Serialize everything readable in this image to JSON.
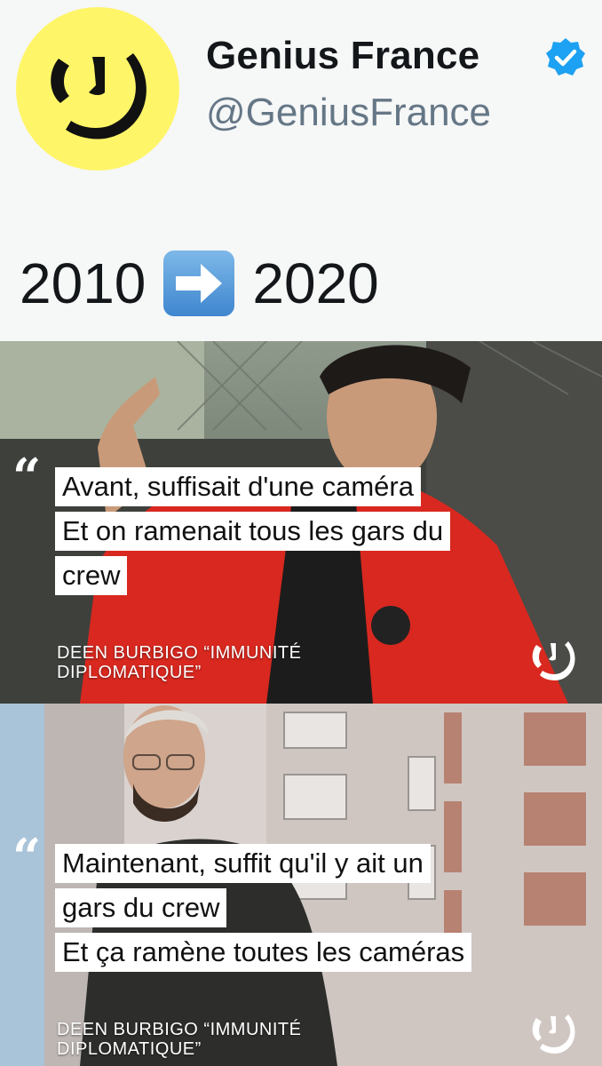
{
  "profile": {
    "name": "Genius France",
    "handle": "@GeniusFrance",
    "verified_icon": "verified-badge-icon",
    "avatar_color": "#fff568"
  },
  "tweet": {
    "text_before": "2010",
    "arrow_icon": "right-arrow-emoji",
    "text_after": "2020"
  },
  "cards": [
    {
      "quote_mark": "“",
      "lines": [
        "Avant, suffisait d'une caméra",
        "Et on ramenait tous les gars du",
        "crew"
      ],
      "caption_line1": "DEEN BURBIGO “IMMUNITÉ",
      "caption_line2": "DIPLOMATIQUE”"
    },
    {
      "quote_mark": "“",
      "lines": [
        "Maintenant, suffit qu'il y ait un",
        "gars du crew",
        "Et ça ramène toutes les caméras"
      ],
      "caption_line1": "DEEN BURBIGO “IMMUNITÉ",
      "caption_line2": "DIPLOMATIQUE”"
    }
  ],
  "colors": {
    "accent_blue": "#1da1f2",
    "genius_yellow": "#fff568",
    "jacket_red": "#d8281f"
  }
}
